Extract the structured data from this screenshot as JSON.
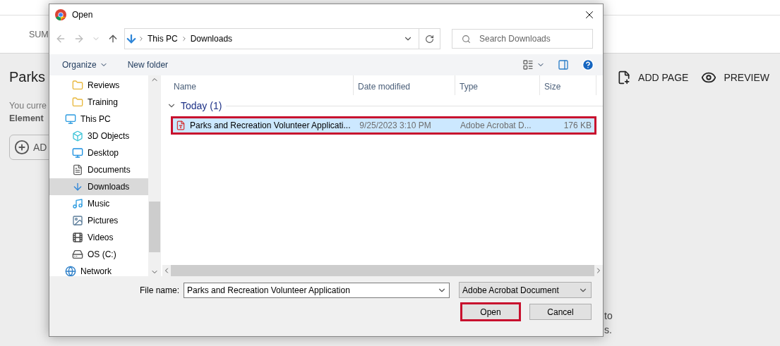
{
  "page": {
    "tab": "SUM",
    "heading": "Parks",
    "line_1": "You curre",
    "line_2": "Element",
    "add_button": "AD",
    "actions": [
      {
        "kind": "add-page",
        "label": "ADD PAGE"
      },
      {
        "kind": "preview",
        "label": "PREVIEW"
      }
    ],
    "footer_lines": [
      "to",
      "s."
    ]
  },
  "dialog": {
    "title": "Open",
    "address": {
      "path": [
        "This PC",
        "Downloads"
      ]
    },
    "search": {
      "placeholder": "Search Downloads"
    },
    "toolbar": {
      "organize": "Organize",
      "new_folder": "New folder"
    },
    "nav_tree": [
      {
        "children": [
          {
            "label": "Reviews",
            "kind": "folder",
            "selected": false
          },
          {
            "label": "Training",
            "kind": "folder",
            "selected": false
          }
        ]
      },
      {
        "label": "This PC",
        "kind": "pc",
        "selected": false,
        "children": [
          {
            "label": "3D Objects",
            "kind": "cube",
            "selected": false
          },
          {
            "label": "Desktop",
            "kind": "desktop",
            "selected": false
          },
          {
            "label": "Documents",
            "kind": "document",
            "selected": false
          },
          {
            "label": "Downloads",
            "kind": "download",
            "selected": true
          },
          {
            "label": "Music",
            "kind": "music",
            "selected": false
          },
          {
            "label": "Pictures",
            "kind": "pictures",
            "selected": false
          },
          {
            "label": "Videos",
            "kind": "videos",
            "selected": false
          },
          {
            "label": "OS (C:)",
            "kind": "drive",
            "selected": false
          }
        ]
      },
      {
        "label": "Network",
        "kind": "network",
        "selected": false
      }
    ],
    "columns": [
      "Name",
      "Date modified",
      "Type",
      "Size"
    ],
    "groups": [
      {
        "label": "Today (1)",
        "expanded": true,
        "rows": [
          {
            "cells": [
              "Parks and Recreation Volunteer Applicati...",
              "9/25/2023 3:10 PM",
              "Adobe Acrobat D...",
              "176 KB"
            ],
            "selected": true,
            "highlighted": true
          }
        ]
      }
    ],
    "file_name": {
      "label": "File name:",
      "value": "Parks and Recreation Volunteer Application"
    },
    "file_type": "Adobe Acrobat Document",
    "buttons": [
      {
        "label": "Open",
        "highlighted": true
      },
      {
        "label": "Cancel",
        "highlighted": false
      }
    ]
  }
}
